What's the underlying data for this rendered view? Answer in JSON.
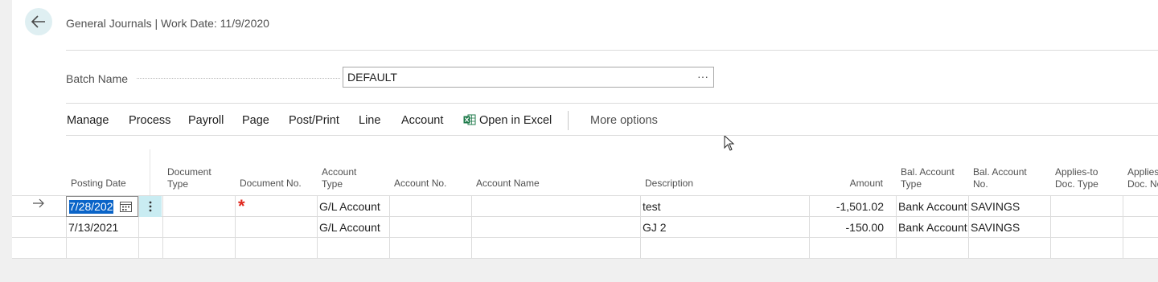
{
  "page": {
    "title": "General Journals | Work Date: 11/9/2020"
  },
  "batch": {
    "label": "Batch Name",
    "value": "DEFAULT",
    "ellipsis": "···"
  },
  "actions": {
    "manage": "Manage",
    "process": "Process",
    "payroll": "Payroll",
    "page": "Page",
    "post_print": "Post/Print",
    "line": "Line",
    "account": "Account",
    "open_in_excel": "Open in Excel",
    "more_options": "More options"
  },
  "columns": {
    "posting_date": "Posting Date",
    "document_type": [
      "Document",
      "Type"
    ],
    "document_no": "Document No.",
    "account_type": [
      "Account",
      "Type"
    ],
    "account_no": "Account No.",
    "account_name": "Account Name",
    "description": "Description",
    "amount": "Amount",
    "bal_account_type": [
      "Bal. Account",
      "Type"
    ],
    "bal_account_no": [
      "Bal. Account",
      "No."
    ],
    "applies_to_doc_type": [
      "Applies-to",
      "Doc. Type"
    ],
    "applies_to_doc_no": [
      "Applies",
      "Doc. No"
    ]
  },
  "rows": [
    {
      "posting_date": "7/28/202",
      "document_type": "",
      "document_no": "",
      "account_type": "G/L Account",
      "account_no": "",
      "account_name": "",
      "description": "test",
      "amount": "-1,501.02",
      "bal_account_type": "Bank Account",
      "bal_account_no": "SAVINGS"
    },
    {
      "posting_date": "7/13/2021",
      "document_type": "",
      "document_no": "",
      "account_type": "G/L Account",
      "account_no": "",
      "account_name": "",
      "description": "GJ 2",
      "amount": "-150.00",
      "bal_account_type": "Bank Account",
      "bal_account_no": "SAVINGS"
    }
  ],
  "icons": {
    "back": "back-arrow-icon",
    "excel": "excel-icon",
    "calendar": "calendar-icon",
    "row_menu": "vertical-ellipsis-icon",
    "current_row": "right-arrow-icon",
    "required": "required-asterisk-icon"
  },
  "colors": {
    "accent": "#0a64c8",
    "back_button_bg": "#dfeff2",
    "row_menu_bg": "#c9ecf2",
    "required": "#e0281e",
    "excel": "#1d7a4a"
  }
}
